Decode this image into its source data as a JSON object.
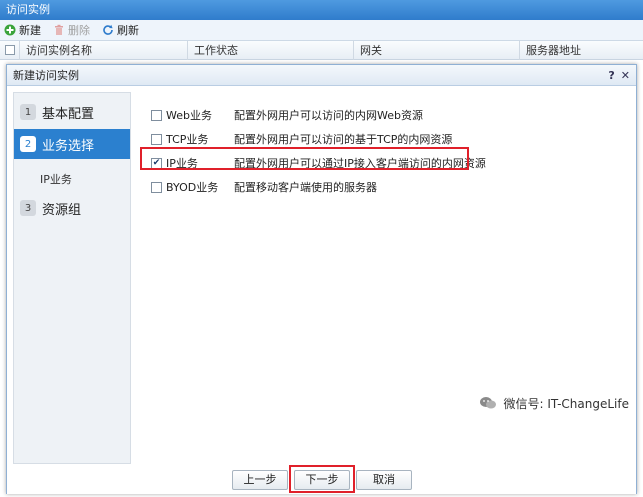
{
  "window": {
    "title": "访问实例"
  },
  "toolbar": {
    "new_label": "新建",
    "delete_label": "删除",
    "refresh_label": "刷新"
  },
  "grid": {
    "columns": [
      "访问实例名称",
      "工作状态",
      "网关",
      "服务器地址"
    ]
  },
  "dialog": {
    "title": "新建访问实例",
    "help_label": "?",
    "close_label": "✕",
    "steps": [
      {
        "num": "1",
        "label": "基本配置"
      },
      {
        "num": "2",
        "label": "业务选择"
      },
      {
        "num": "3",
        "label": "资源组"
      }
    ],
    "substep": "IP业务",
    "services": [
      {
        "name": "Web业务",
        "desc": "配置外网用户可以访问的内网Web资源",
        "checked": false
      },
      {
        "name": "TCP业务",
        "desc": "配置外网用户可以访问的基于TCP的内网资源",
        "checked": false
      },
      {
        "name": "IP业务",
        "desc": "配置外网用户可以通过IP接入客户端访问的内网资源",
        "checked": true
      },
      {
        "name": "BYOD业务",
        "desc": "配置移动客户端使用的服务器",
        "checked": false
      }
    ],
    "buttons": {
      "prev": "上一步",
      "next": "下一步",
      "cancel": "取消"
    }
  },
  "watermark": {
    "text": "微信号: IT-ChangeLife"
  },
  "colors": {
    "accent": "#2b80cf",
    "highlight": "#e0202a",
    "title_bar": "#3f8bd6"
  }
}
